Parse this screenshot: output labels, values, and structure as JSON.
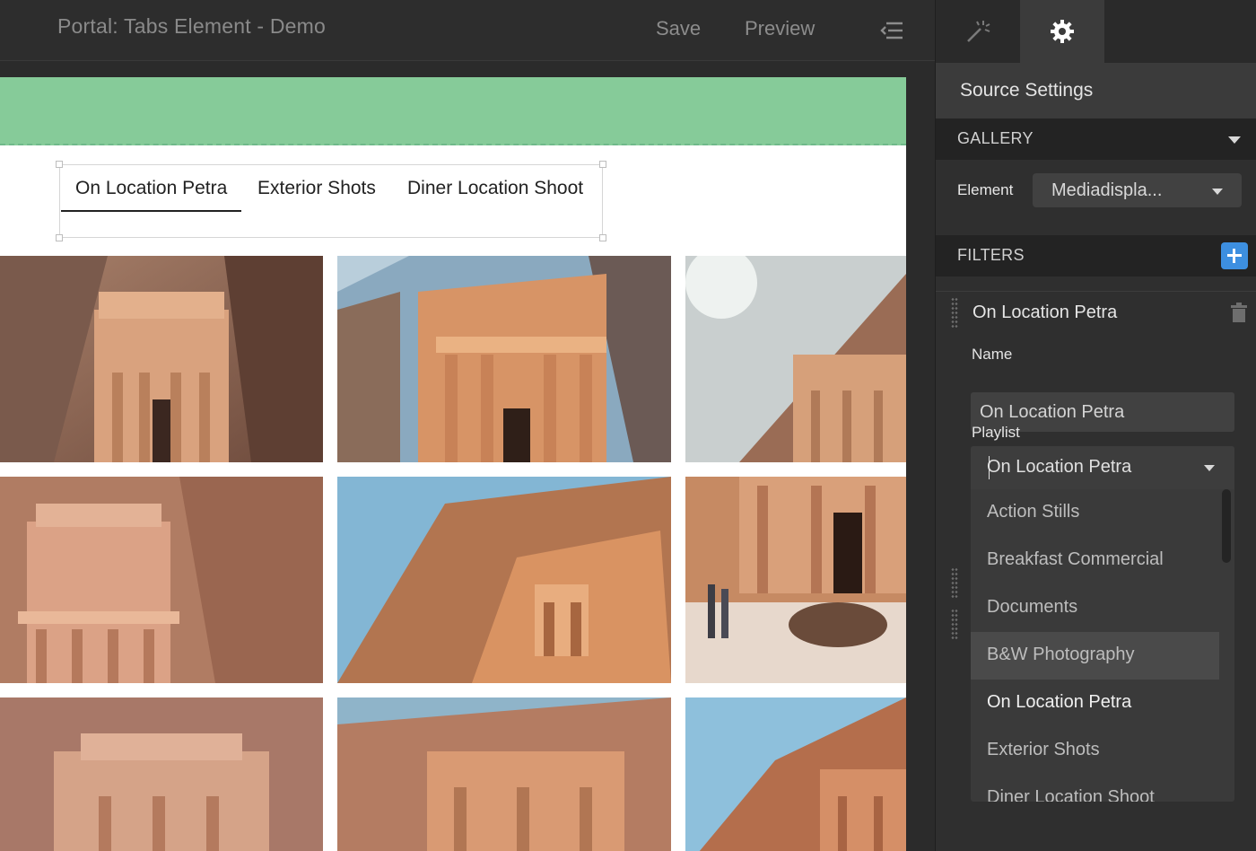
{
  "topbar": {
    "title": "Portal: Tabs Element - Demo",
    "save_label": "Save",
    "preview_label": "Preview"
  },
  "tabs": [
    {
      "label": "On Location Petra",
      "active": true
    },
    {
      "label": "Exterior Shots",
      "active": false
    },
    {
      "label": "Diner Location Shoot",
      "active": false
    }
  ],
  "panel": {
    "source_settings": "Source Settings",
    "gallery_section": "GALLERY",
    "element_label": "Element",
    "element_value": "Mediadispla...",
    "filters_section": "FILTERS",
    "filter": {
      "title": "On Location Petra",
      "name_label": "Name",
      "name_value": "On Location Petra",
      "playlist_label": "Playlist",
      "playlist_current": "On Location Petra",
      "options": [
        "Action Stills",
        "Breakfast Commercial",
        "Documents",
        "B&W Photography",
        "On Location Petra",
        "Exterior Shots",
        "Diner Location Shoot"
      ],
      "hovered_option": "B&W Photography",
      "selected_option": "On Location Petra"
    }
  },
  "colors": {
    "banner": "#86cb99",
    "accent": "#3d8fe0",
    "panel_bg": "#2f2f2f"
  },
  "icons": [
    "magic-wand-icon",
    "gear-icon",
    "collapse-panel-icon",
    "plus-icon",
    "trash-icon",
    "drag-handle-icon",
    "caret-down-icon"
  ]
}
